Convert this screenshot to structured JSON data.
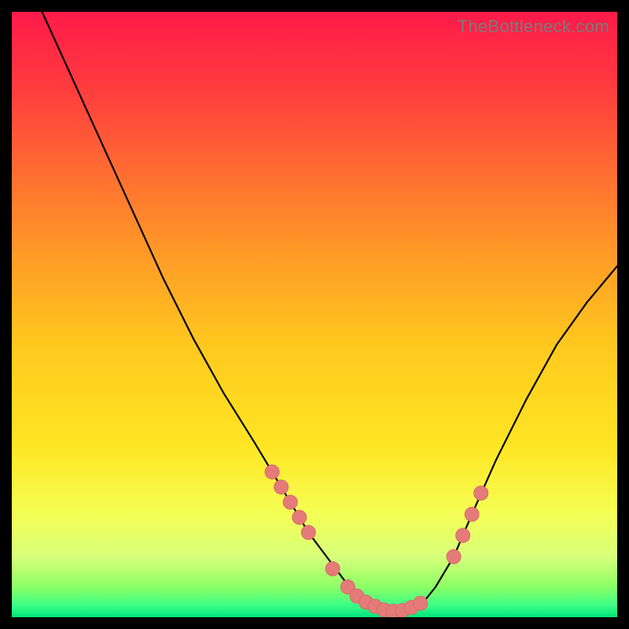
{
  "watermark": "TheBottleneck.com",
  "colors": {
    "background": "#000000",
    "gradient_top": "#ff1a4a",
    "gradient_mid": "#ffd400",
    "gradient_green_light": "#8cff66",
    "gradient_green": "#00e57a",
    "curve": "#000000",
    "marker_fill": "#e47b79",
    "marker_stroke": "#d86a68",
    "watermark": "#7a7a7a"
  },
  "chart_data": {
    "type": "line",
    "title": "",
    "xlabel": "",
    "ylabel": "",
    "xlim": [
      0,
      100
    ],
    "ylim": [
      0,
      100
    ],
    "grid": false,
    "legend": false,
    "series": [
      {
        "name": "bottleneck-curve",
        "x": [
          5,
          10,
          15,
          20,
          25,
          30,
          35,
          40,
          43,
          46,
          49,
          52,
          55,
          57,
          59,
          61,
          63,
          65,
          68,
          70,
          73,
          76,
          80,
          85,
          90,
          95,
          100
        ],
        "y": [
          100,
          89,
          78,
          67,
          56,
          46,
          37,
          29,
          24,
          19,
          14,
          10,
          6,
          4,
          2.5,
          1.5,
          1,
          1.2,
          2.5,
          5,
          10,
          17,
          26,
          36,
          45,
          52,
          58
        ]
      }
    ],
    "markers": [
      {
        "x": 43,
        "y": 24
      },
      {
        "x": 44.5,
        "y": 21.5
      },
      {
        "x": 46,
        "y": 19
      },
      {
        "x": 47.5,
        "y": 16.5
      },
      {
        "x": 49,
        "y": 14
      },
      {
        "x": 53,
        "y": 8
      },
      {
        "x": 55.5,
        "y": 5
      },
      {
        "x": 57,
        "y": 3.5
      },
      {
        "x": 58.5,
        "y": 2.5
      },
      {
        "x": 60,
        "y": 1.8
      },
      {
        "x": 61.5,
        "y": 1.2
      },
      {
        "x": 63,
        "y": 1
      },
      {
        "x": 64.5,
        "y": 1.1
      },
      {
        "x": 66,
        "y": 1.6
      },
      {
        "x": 67.5,
        "y": 2.3
      },
      {
        "x": 73,
        "y": 10
      },
      {
        "x": 74.5,
        "y": 13.5
      },
      {
        "x": 76,
        "y": 17
      },
      {
        "x": 77.5,
        "y": 20.5
      }
    ],
    "annotations": []
  }
}
